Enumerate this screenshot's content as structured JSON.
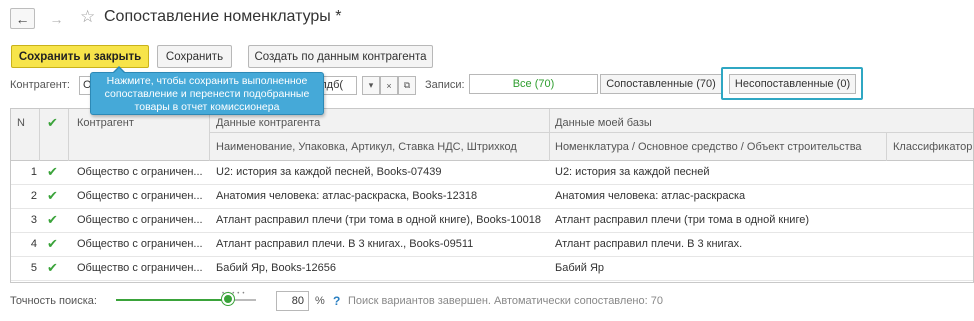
{
  "window": {
    "title": "Сопоставление номенклатуры *"
  },
  "toolbar": {
    "save_close_label": "Сохранить и закрыть",
    "save_label": "Сохранить",
    "create_label": "Создать по данным контрагента"
  },
  "filter": {
    "counterparty_label": "Контрагент:",
    "counterparty_prefix": "О",
    "counterparty_value": "айлдб(",
    "records_label": "Записи:",
    "all_label": "Все (70)",
    "matched_label": "Сопоставленные (70)",
    "unmatched_label": "Несопоставленные (0)"
  },
  "tooltip": {
    "text": "Нажмите, чтобы сохранить выполненное сопоставление и перенести подобранные товары в отчет комиссионера"
  },
  "grid": {
    "headers": {
      "n": "N",
      "counterparty": "Контрагент",
      "cp_data": "Данные контрагента",
      "cp_data_sub": "Наименование, Упаковка, Артикул, Ставка НДС, Штрихкод",
      "my_data": "Данные моей базы",
      "my_data_sub": "Номенклатура / Основное средство / Объект строительства",
      "classifier": "Классификатор"
    },
    "rows": [
      {
        "n": "1",
        "counterparty": "Общество с ограничен...",
        "cp_data": "U2: история за каждой песней, Books-07439",
        "my_data": "U2: история за каждой песней"
      },
      {
        "n": "2",
        "counterparty": "Общество с ограничен...",
        "cp_data": "Анатомия человека: атлас-раскраска, Books-12318",
        "my_data": "Анатомия человека: атлас-раскраска"
      },
      {
        "n": "3",
        "counterparty": "Общество с ограничен...",
        "cp_data": "Атлант расправил плечи (три тома в одной книге), Books-10018",
        "my_data": "Атлант расправил плечи (три тома в одной книге)"
      },
      {
        "n": "4",
        "counterparty": "Общество с ограничен...",
        "cp_data": "Атлант расправил плечи. В 3 книгах., Books-09511",
        "my_data": "Атлант расправил плечи. В 3 книгах."
      },
      {
        "n": "5",
        "counterparty": "Общество с ограничен...",
        "cp_data": "Бабий Яр, Books-12656",
        "my_data": "Бабий Яр"
      }
    ]
  },
  "footer": {
    "precision_label": "Точность поиска:",
    "precision_value": "80",
    "precision_fraction": 0.8,
    "percent": "%",
    "help": "?",
    "status": "Поиск вариантов завершен. Автоматически сопоставлено: 70"
  },
  "colors": {
    "primary": "#f7e44a",
    "check": "#3aa33a",
    "tooltip": "#45a9d8",
    "highlight": "#2fa7c3"
  }
}
